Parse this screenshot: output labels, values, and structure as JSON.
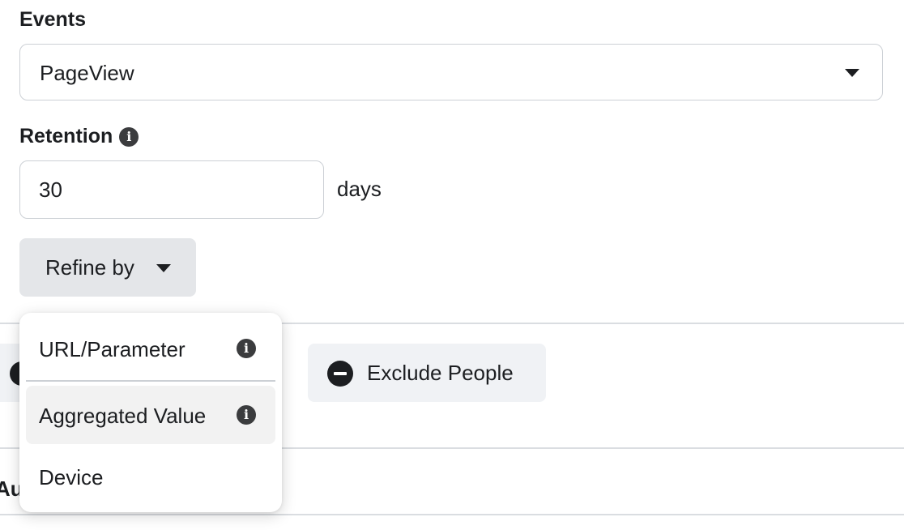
{
  "events": {
    "label": "Events",
    "selected": "PageView",
    "caret_icon": "caret-down-icon"
  },
  "retention": {
    "label": "Retention",
    "info_icon": "info-icon",
    "value": "30",
    "unit": "days"
  },
  "refine": {
    "label": "Refine by",
    "caret_icon": "caret-down-icon"
  },
  "dropdown": {
    "items": [
      {
        "label": "URL/Parameter",
        "has_info": true
      },
      {
        "label": "Aggregated Value",
        "has_info": true,
        "highlighted": true
      },
      {
        "label": "Device",
        "has_info": false
      }
    ]
  },
  "actions": {
    "exclude_label": "Exclude People",
    "exclude_icon": "minus-circle-icon",
    "include_icon": "minus-circle-icon"
  },
  "section": {
    "heading_partial": "Au"
  },
  "colors": {
    "border": "#ccd0d5",
    "button_bg": "#e4e6e9",
    "action_bg": "#f0f2f5",
    "text": "#1c1e21"
  }
}
